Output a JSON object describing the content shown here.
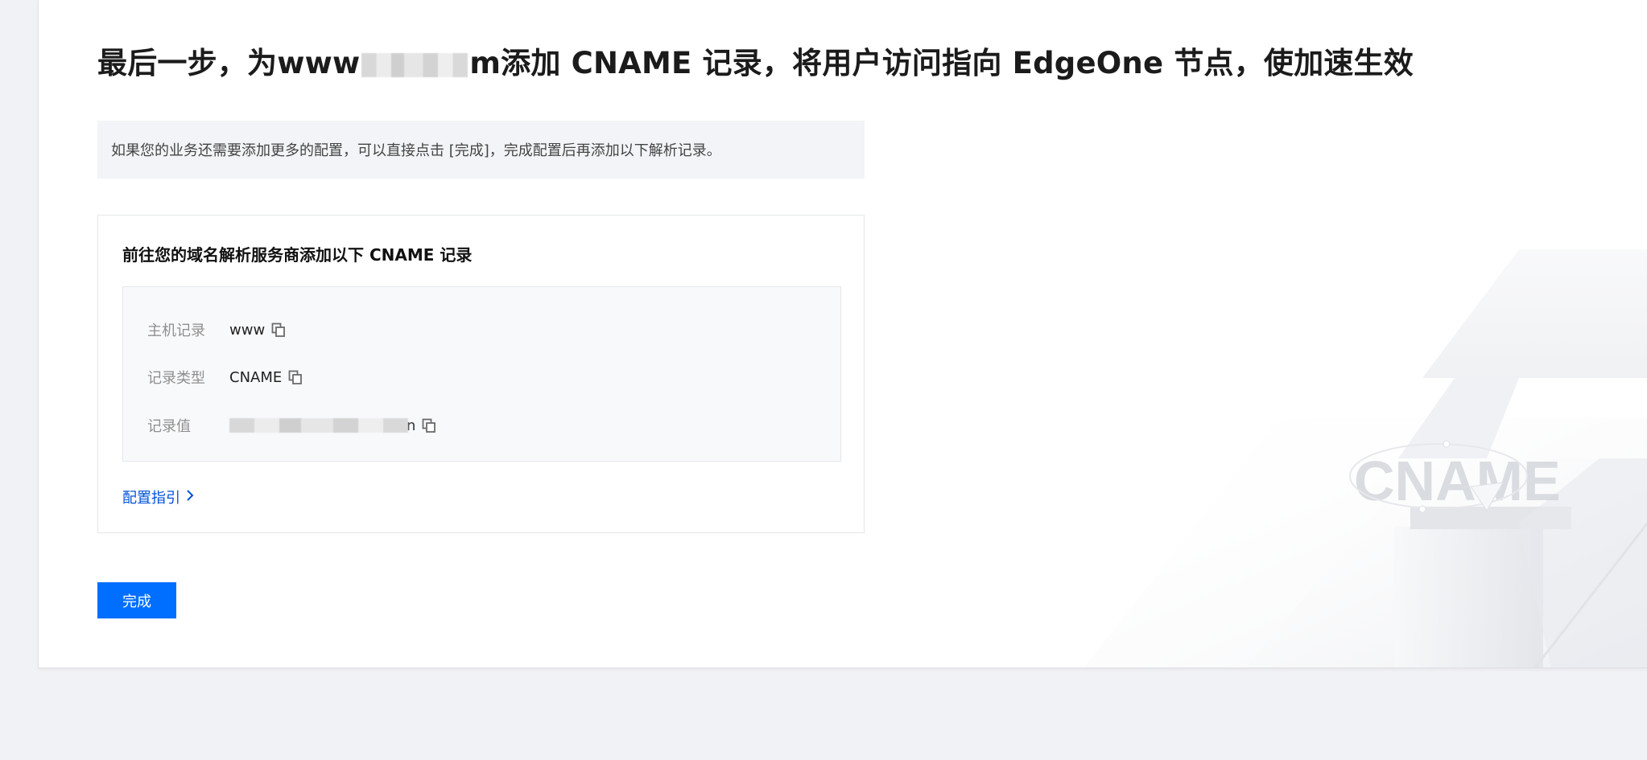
{
  "page": {
    "title_before": "最后一步，为www",
    "title_tail": "m添加 CNAME 记录，将用户访问指向 EdgeOne 节点，使加速生效"
  },
  "notice": {
    "text": "如果您的业务还需要添加更多的配置，可以直接点击 [完成]，完成配置后再添加以下解析记录。"
  },
  "record_panel": {
    "title": "前往您的域名解析服务商添加以下 CNAME 记录",
    "rows": [
      {
        "label": "主机记录",
        "value": "www"
      },
      {
        "label": "记录类型",
        "value": "CNAME"
      },
      {
        "label": "记录值",
        "value": "",
        "value_tail": "n"
      }
    ],
    "guide_link": "配置指引",
    "copy_icon": "copy-icon",
    "chevron_icon": "chevron-right-icon"
  },
  "actions": {
    "done_label": "完成"
  },
  "decoration": {
    "illustration_text": "CNAME"
  },
  "colors": {
    "primary": "#006eff",
    "link": "#0052d9",
    "page_bg": "#f1f2f5"
  }
}
